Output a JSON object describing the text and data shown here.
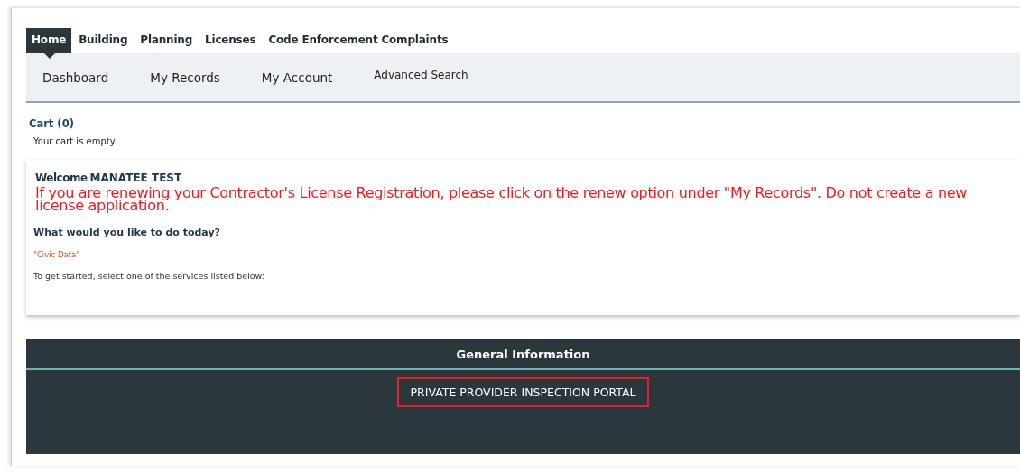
{
  "tabs": [
    {
      "label": "Home",
      "selected": true
    },
    {
      "label": "Building",
      "selected": false
    },
    {
      "label": "Planning",
      "selected": false
    },
    {
      "label": "Licenses",
      "selected": false
    },
    {
      "label": "Code Enforcement Complaints",
      "selected": false
    }
  ],
  "subnav": [
    {
      "label": "Dashboard",
      "kind": "main"
    },
    {
      "label": "My Records",
      "kind": "main"
    },
    {
      "label": "My Account",
      "kind": "main"
    },
    {
      "label": "Advanced Search",
      "kind": "small"
    }
  ],
  "cart": {
    "title": "Cart (0)",
    "message": "Your cart is empty."
  },
  "welcome": {
    "greeting": "Welcome",
    "user": "MANATEE TEST",
    "notice": "If you are renewing your Contractor's License Registration, please click on the renew option under \"My Records\". Do not create a new license application.",
    "question": "What would you like to do today?",
    "tag": "\"Civic Data\"",
    "instruction": "To get started, select one of the services listed below:"
  },
  "general_information": {
    "title": "General Information",
    "links": [
      {
        "label": "PRIVATE PROVIDER INSPECTION PORTAL",
        "highlighted": true
      }
    ]
  }
}
